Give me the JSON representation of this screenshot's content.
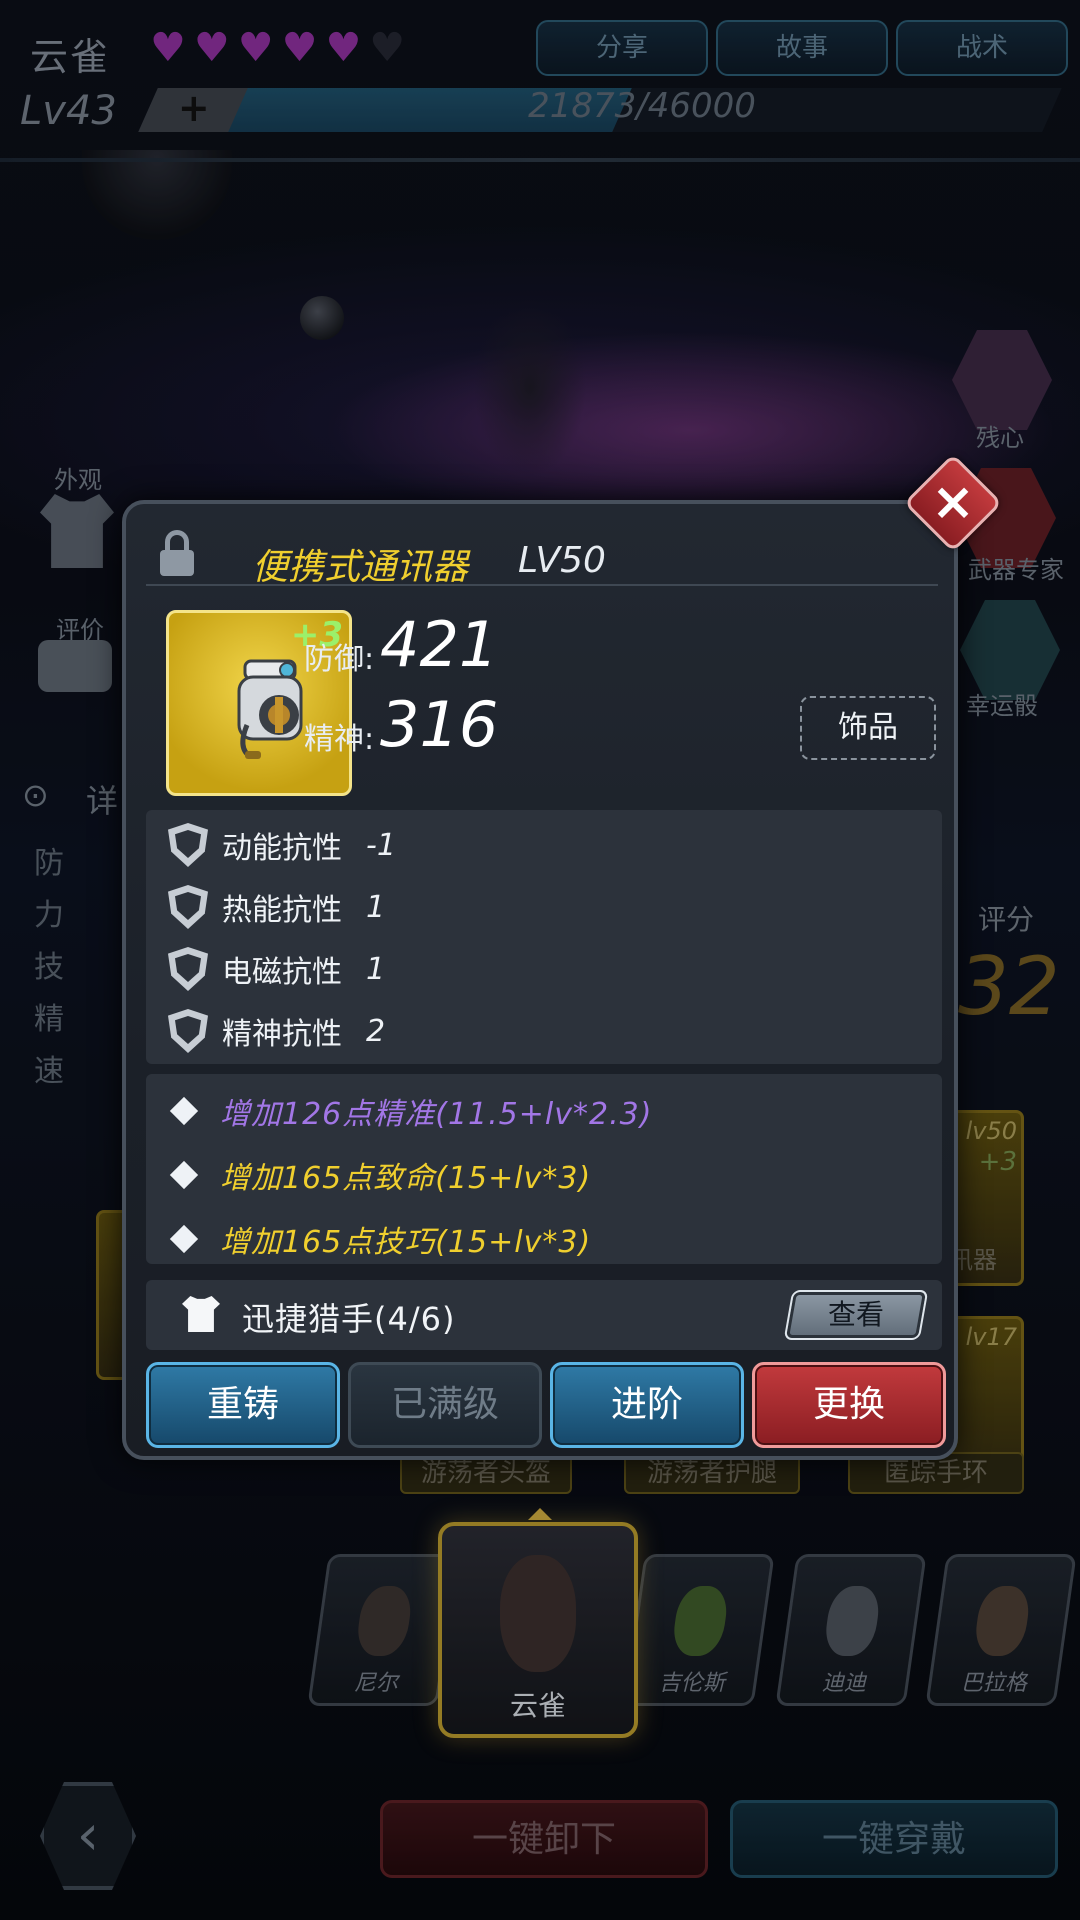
{
  "hero": {
    "name": "云雀",
    "level": "Lv43",
    "level_plus": "+",
    "xp_text": "21873/46000",
    "xp_progress": 0.475,
    "hearts_filled": 5,
    "hearts_total": 6
  },
  "top_tabs": [
    "分享",
    "故事",
    "战术"
  ],
  "side_left": {
    "appearance_label": "外观",
    "rating_label": "评价",
    "detail_label": "详",
    "stat_initials": [
      "防",
      "力",
      "技",
      "精",
      "速"
    ]
  },
  "side_right": {
    "skill_label": "残心",
    "weapon_expert_label": "武器专家",
    "lucky_dice_label": "幸运骰"
  },
  "score": {
    "label": "评分",
    "value": "32"
  },
  "equip_slots": {
    "right_slot_level": "lv50",
    "right_slot_plus": "+3",
    "right_slot_name": "讯器",
    "right2_level": "lv17",
    "slot_names": [
      "游荡者头盔",
      "游荡者护腿",
      "匿踪手环"
    ]
  },
  "roster": {
    "heroes": [
      "尼尔",
      "云雀",
      "吉伦斯",
      "迪迪",
      "巴拉格"
    ],
    "active_index": 1
  },
  "bottom": {
    "back_glyph": "‹",
    "unequip_all": "一键卸下",
    "equip_all": "一键穿戴"
  },
  "dialog": {
    "close_glyph": "×",
    "item_name": "便携式通讯器",
    "item_level": "LV50",
    "enhance_level": "+3",
    "type_tag": "饰品",
    "main_stats": [
      {
        "label": "防御:",
        "value": "421"
      },
      {
        "label": "精神:",
        "value": "316"
      }
    ],
    "resistances": [
      {
        "icon": "kinetic-resist-icon",
        "label": "动能抗性",
        "value": "-1"
      },
      {
        "icon": "thermal-resist-icon",
        "label": "热能抗性",
        "value": "1"
      },
      {
        "icon": "em-resist-icon",
        "label": "电磁抗性",
        "value": "1"
      },
      {
        "icon": "mental-resist-icon",
        "label": "精神抗性",
        "value": "2"
      }
    ],
    "bonuses": [
      {
        "text": "增加126点精准(11.5+lv*2.3)",
        "color": "#a276e6"
      },
      {
        "text": "增加165点致命(15+lv*3)",
        "color": "#f0cf2e"
      },
      {
        "text": "增加165点技巧(15+lv*3)",
        "color": "#f0cf2e"
      }
    ],
    "set": {
      "name": "迅捷猎手(4/6)",
      "view_label": "查看"
    },
    "actions": [
      {
        "label": "重铸",
        "style": "blue"
      },
      {
        "label": "已满级",
        "style": "gray"
      },
      {
        "label": "进阶",
        "style": "blue"
      },
      {
        "label": "更换",
        "style": "red"
      }
    ]
  },
  "colors": {
    "gold_title": "#f0cf2e",
    "purple_bonus": "#a276e6",
    "heart": "#8a2f9a",
    "close_red": "#c23a3d"
  }
}
